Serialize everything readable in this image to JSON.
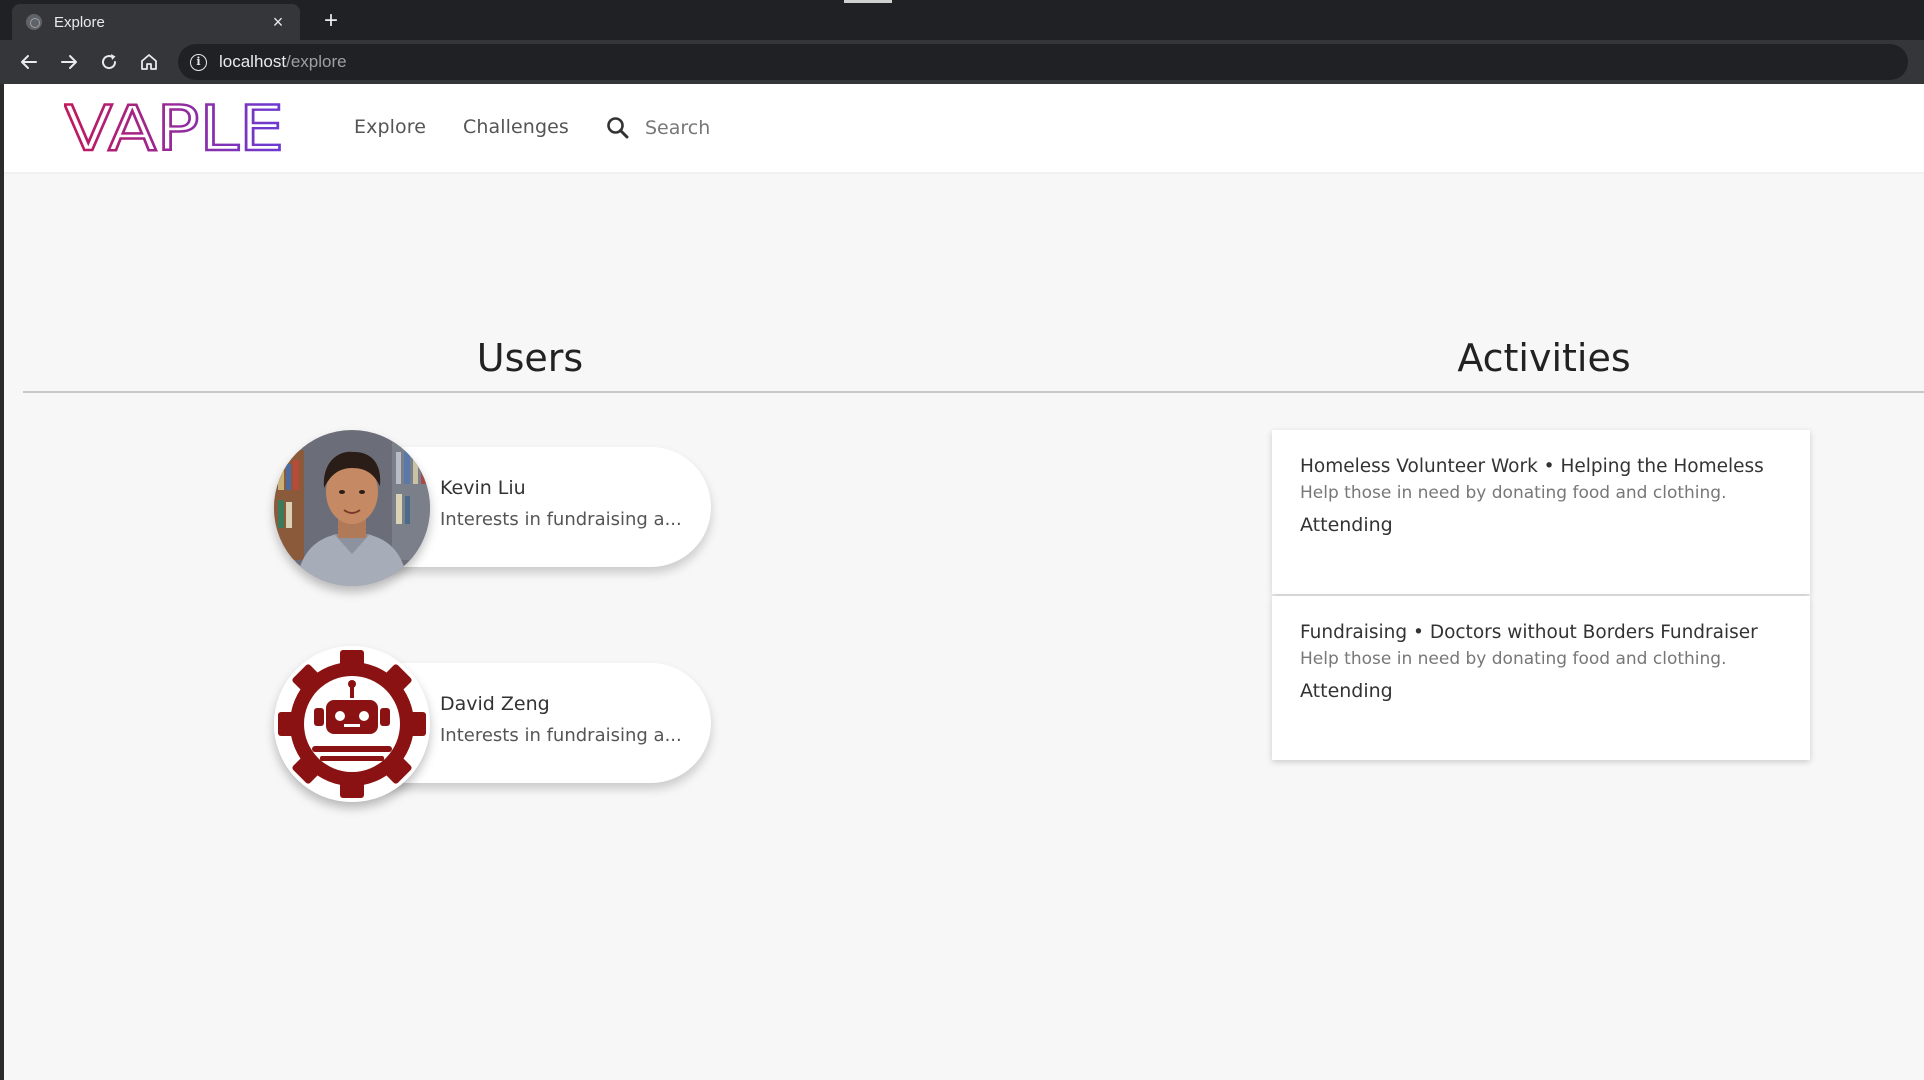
{
  "browser": {
    "tab_title": "Explore",
    "tab_close": "×",
    "new_tab": "+",
    "url_host": "localhost",
    "url_path": "/explore"
  },
  "header": {
    "logo_text": "VAPLE",
    "nav": {
      "explore": "Explore",
      "challenges": "Challenges"
    },
    "search_placeholder": "Search"
  },
  "sections": {
    "users_title": "Users",
    "activities_title": "Activities"
  },
  "users": [
    {
      "name": "Kevin Liu",
      "interests": "Interests in fundraising a..."
    },
    {
      "name": "David Zeng",
      "interests": "Interests in fundraising a..."
    }
  ],
  "activities": [
    {
      "title": "Homeless Volunteer Work • Helping the Homeless",
      "description": "Help those in need by donating food and clothing.",
      "status": "Attending"
    },
    {
      "title": "Fundraising • Doctors without Borders Fundraiser",
      "description": "Help those in need by donating food and clothing.",
      "status": "Attending"
    }
  ],
  "colors": {
    "logo_gradient_start": "#c2185b",
    "logo_gradient_end": "#6a3bd6",
    "robot_avatar": "#8b1212",
    "page_background": "#f7f7f7"
  },
  "icons": {
    "back": "back-arrow-icon",
    "forward": "forward-arrow-icon",
    "reload": "reload-icon",
    "home": "home-icon",
    "site_info": "info-icon",
    "search": "search-icon"
  }
}
